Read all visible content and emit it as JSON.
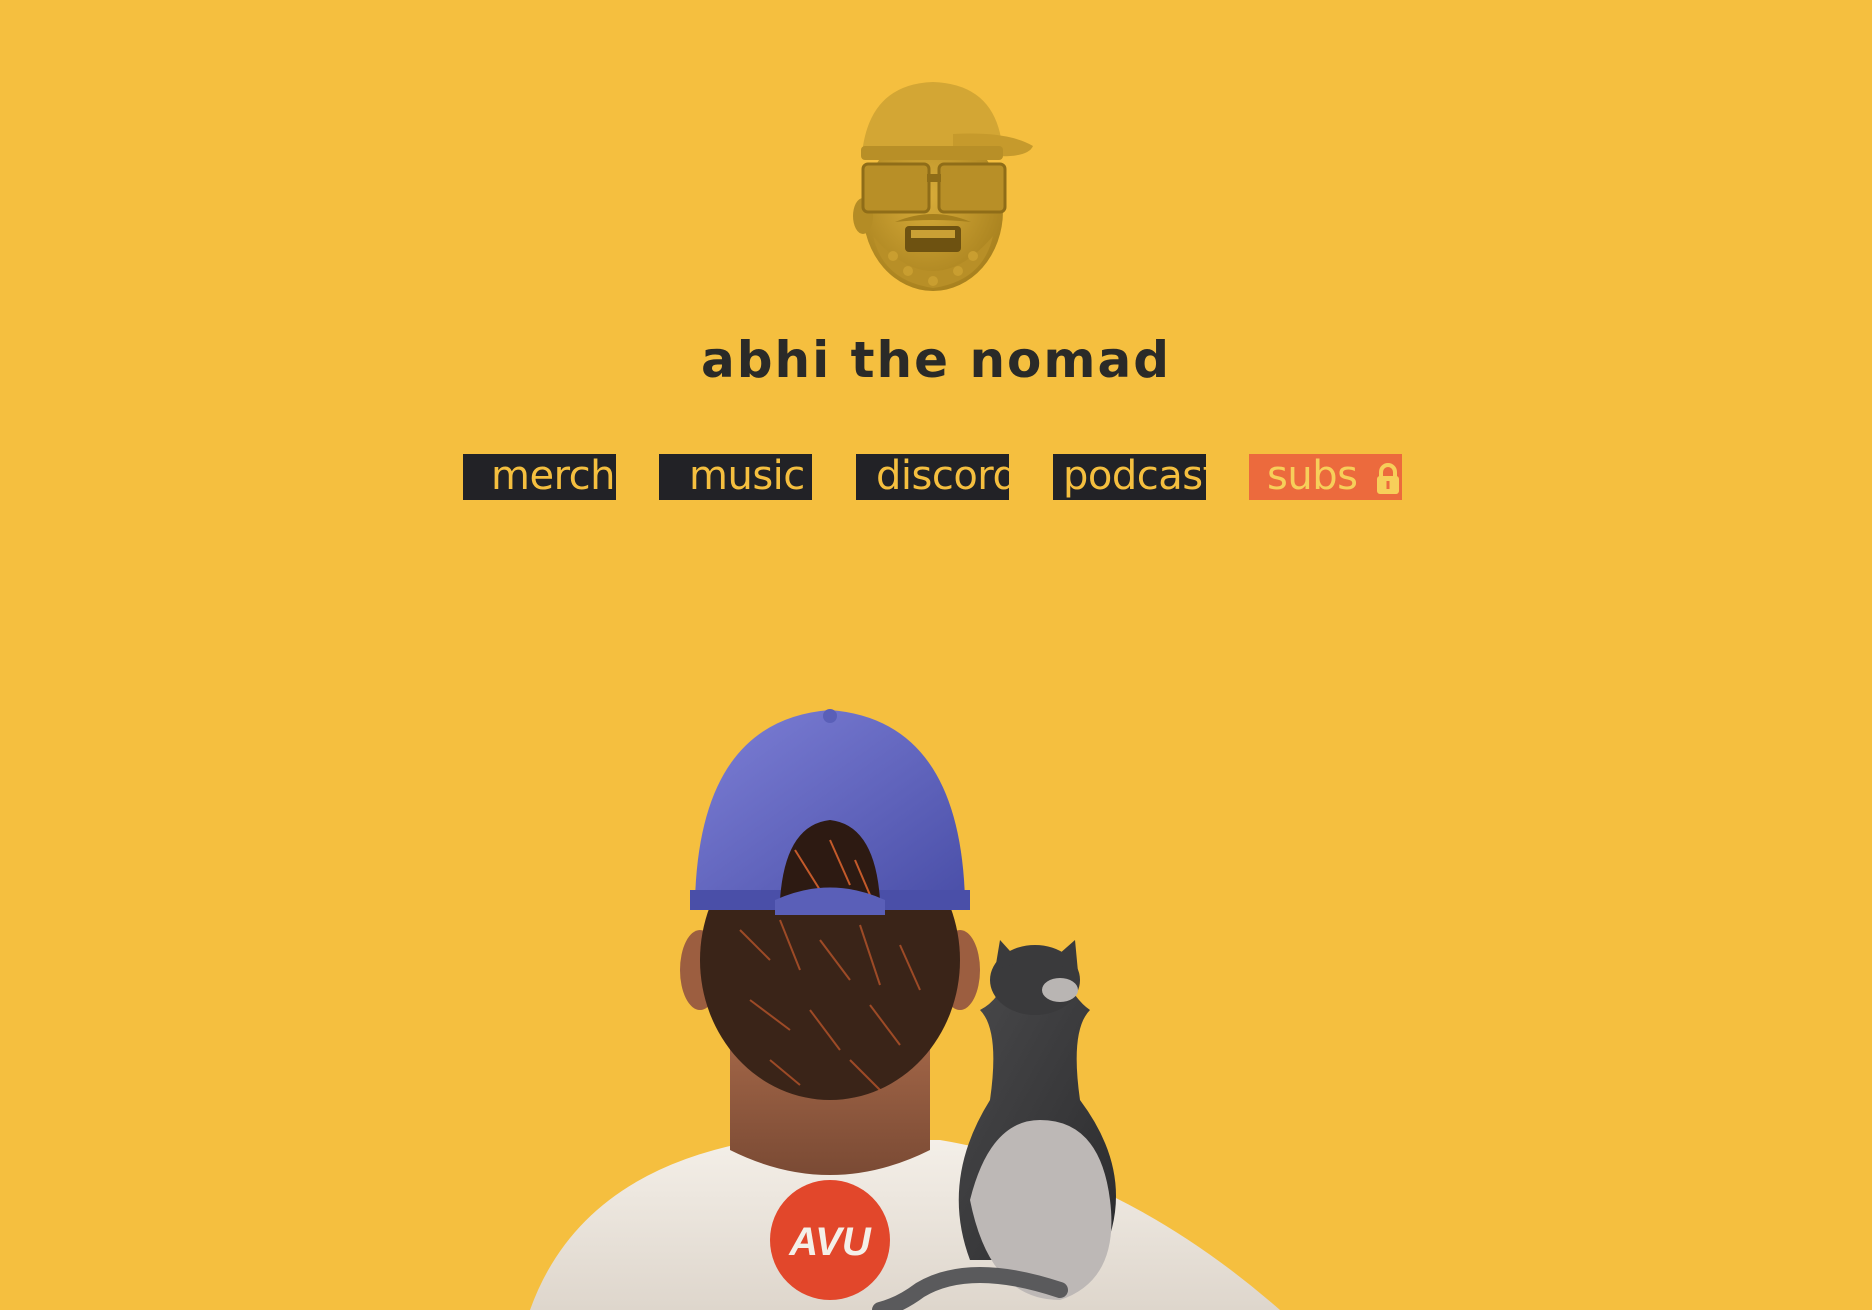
{
  "site": {
    "title": "abhi the nomad"
  },
  "nav": {
    "items": [
      {
        "label": "merch"
      },
      {
        "label": "music"
      },
      {
        "label": "discord"
      },
      {
        "label": "podcast"
      },
      {
        "label": "subs",
        "icon": "lock-icon"
      }
    ]
  },
  "colors": {
    "background": "#f5bf3f",
    "button_dark": "#222226",
    "button_accent": "#ec6a3d",
    "title_text": "#2a2a28"
  },
  "hero": {
    "shirt_logo": "AVU"
  }
}
